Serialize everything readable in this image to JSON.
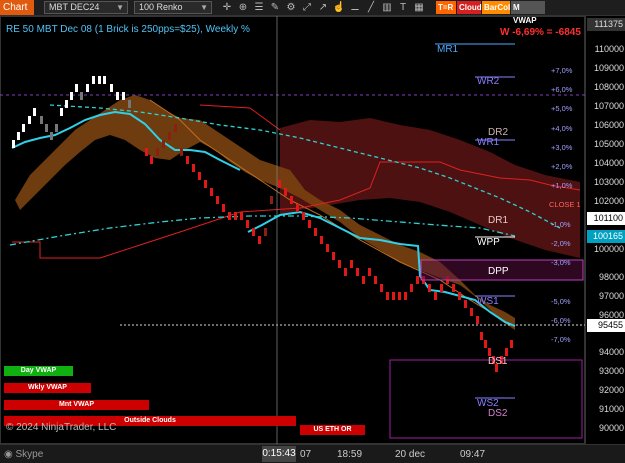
{
  "toolbar": {
    "chart_label": "Chart",
    "instrument": "MBT DEC24",
    "bar_type": "100 Renko",
    "tags": [
      {
        "label": "T=R",
        "color": "#ff6600"
      },
      {
        "label": "Cloud",
        "color": "#d42020"
      },
      {
        "label": "BarCol",
        "color": "#ff8c00"
      },
      {
        "label": "M VWAP",
        "color": "#555555"
      }
    ]
  },
  "chart": {
    "title": "RE 50 MBT Dec 08 (1 Brick is 250pps=$25), Weekly %",
    "week_change": "W -6,69% = -6845",
    "y_labels": [
      "100000",
      "99000",
      "98000",
      "97000",
      "96000",
      "94000",
      "93000",
      "92000",
      "91000",
      "90000",
      "102000",
      "103000",
      "104000",
      "105000",
      "106000",
      "107000",
      "108000",
      "109000",
      "110000"
    ],
    "price_top": "111375",
    "price_boxes": [
      {
        "label": "101100",
        "bg": "#ffffff",
        "fg": "#000000"
      },
      {
        "label": "100165",
        "bg": "#00a0c0",
        "fg": "#ffffff"
      },
      {
        "label": "95455",
        "bg": "#ffffff",
        "fg": "#000000"
      }
    ],
    "levels": [
      {
        "label": "MR1",
        "color": "#4ea8ff"
      },
      {
        "label": "WR2",
        "color": "#8a7fff"
      },
      {
        "label": "DR2",
        "color": "#d0b0b0"
      },
      {
        "label": "WR1",
        "color": "#8a7fff"
      },
      {
        "label": "DR1",
        "color": "#e8c8c8"
      },
      {
        "label": "WPP",
        "color": "#ffffff"
      },
      {
        "label": "DPP",
        "color": "#ffffff"
      },
      {
        "label": "WS1",
        "color": "#8a7fff"
      },
      {
        "label": "DS1",
        "color": "#ffc0c0"
      },
      {
        "label": "WS2",
        "color": "#8a7fff"
      },
      {
        "label": "DS2",
        "color": "#d080d0"
      }
    ],
    "pct_labels": [
      {
        "label": "+7,0%",
        "color": "#a0a0ff"
      },
      {
        "label": "+6,0%",
        "color": "#a0a0ff"
      },
      {
        "label": "+5,0%",
        "color": "#a0a0ff"
      },
      {
        "label": "+4,0%",
        "color": "#a0a0ff"
      },
      {
        "label": "+3,0%",
        "color": "#a0a0ff"
      },
      {
        "label": "+2,0%",
        "color": "#a0a0ff"
      },
      {
        "label": "+1,0%",
        "color": "#a0a0ff"
      },
      {
        "label": "CLOSE 1",
        "color": "#ff6060"
      },
      {
        "label": "-1,0%",
        "color": "#a0a0ff"
      },
      {
        "label": "-2,0%",
        "color": "#a0a0ff"
      },
      {
        "label": "-3,0%",
        "color": "#a0a0ff"
      },
      {
        "label": "-5,0%",
        "color": "#a0a0ff"
      },
      {
        "label": "-6,0%",
        "color": "#a0a0ff"
      },
      {
        "label": "-7,0%",
        "color": "#a0a0ff"
      }
    ],
    "vwap_buttons": [
      {
        "label": "Day VWAP",
        "color": "#10b010"
      },
      {
        "label": "Wkly VWAP",
        "color": "#cc0000"
      },
      {
        "label": "Mnt VWAP",
        "color": "#cc0000"
      },
      {
        "label": "Outside Clouds",
        "color": "#cc0000"
      },
      {
        "label": "US ETH OR",
        "color": "#cc0000"
      }
    ],
    "copyright": "© 2024 NinjaTrader, LLC"
  },
  "timeline": {
    "app": "Skype",
    "clock": "0:15:43",
    "labels": [
      "07",
      "18:59",
      "20 dec",
      "09:47"
    ]
  }
}
